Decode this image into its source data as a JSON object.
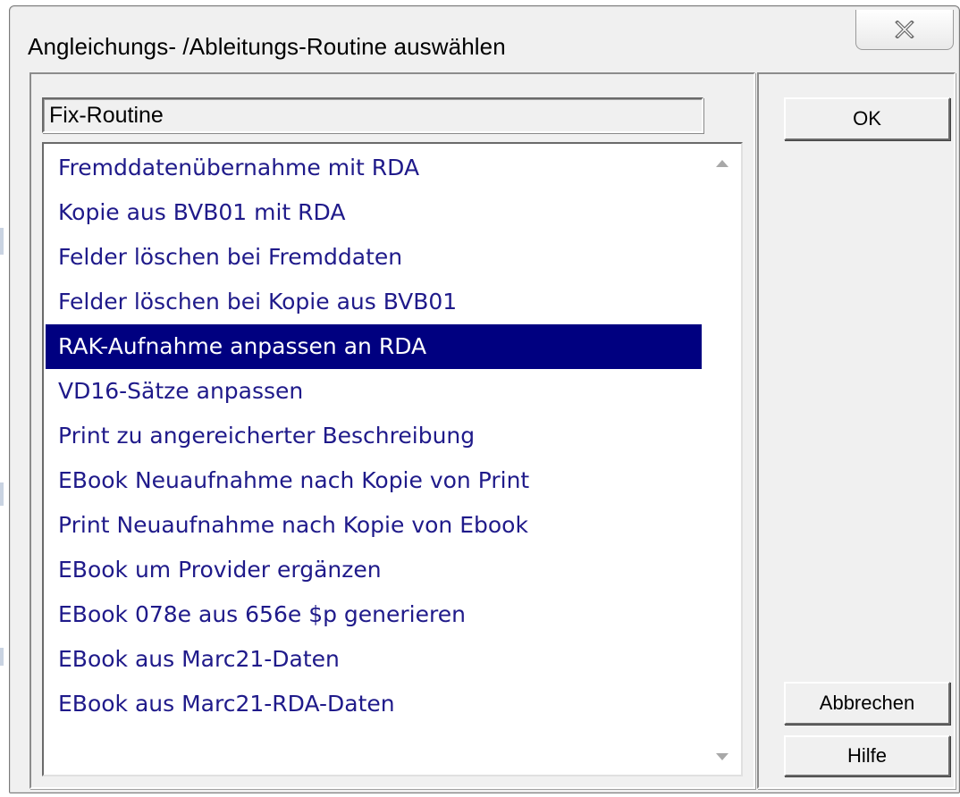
{
  "window": {
    "title": "Angleichungs- /Ableitungs-Routine auswählen",
    "close_icon": "close-icon"
  },
  "combo": {
    "value": "Fix-Routine"
  },
  "list": {
    "items": [
      {
        "label": "Fremddatenübernahme mit RDA"
      },
      {
        "label": "Kopie aus BVB01 mit RDA"
      },
      {
        "label": "Felder löschen bei Fremddaten"
      },
      {
        "label": "Felder löschen bei Kopie aus BVB01"
      },
      {
        "label": "RAK-Aufnahme anpassen an RDA",
        "selected": true
      },
      {
        "label": "VD16-Sätze anpassen"
      },
      {
        "label": "Print zu angereicherter Beschreibung"
      },
      {
        "label": "EBook Neuaufnahme nach Kopie von Print"
      },
      {
        "label": "Print Neuaufnahme nach Kopie von Ebook"
      },
      {
        "label": "EBook um Provider ergänzen"
      },
      {
        "label": "EBook 078e aus 656e $p generieren"
      },
      {
        "label": "EBook aus Marc21-Daten"
      },
      {
        "label": "EBook aus Marc21-RDA-Daten"
      }
    ],
    "selected_index": 4,
    "text_color": "#1f1a8a",
    "selection_color": "#000080"
  },
  "buttons": {
    "ok_label": "OK",
    "cancel_label": "Abbrechen",
    "help_label": "Hilfe"
  },
  "icons": {
    "scroll_up": "scroll-up-arrow-icon",
    "scroll_down": "scroll-down-arrow-icon"
  }
}
